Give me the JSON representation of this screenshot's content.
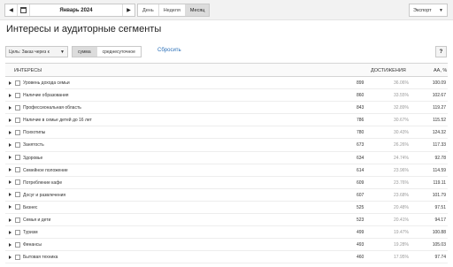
{
  "toolbar": {
    "date_label": "Январь 2024",
    "periods": [
      {
        "label": "День",
        "active": false
      },
      {
        "label": "Неделя",
        "active": false
      },
      {
        "label": "Месяц",
        "active": true
      }
    ],
    "export_label": "Экспорт"
  },
  "page_title": "Интересы и аудиторные сегменты",
  "filters": {
    "goal_label": "Цель: Заказ через к",
    "modes": [
      {
        "label": "сумма",
        "active": true
      },
      {
        "label": "среднесуточное",
        "active": false
      }
    ],
    "reset_label": "Сбросить",
    "help_label": "?"
  },
  "table": {
    "headers": {
      "name": "ИНТЕРЕСЫ",
      "reach": "ДОСТИЖЕНИЯ",
      "affinity": "АА, %"
    },
    "rows": [
      {
        "name": "Уровень дохода семьи",
        "count": "899",
        "pct": "36.06%",
        "aff": "100.09"
      },
      {
        "name": "Наличие образования",
        "count": "860",
        "pct": "33.55%",
        "aff": "102.67"
      },
      {
        "name": "Профессиональная область",
        "count": "843",
        "pct": "32.89%",
        "aff": "119.27"
      },
      {
        "name": "Наличие в семье детей до 16 лет",
        "count": "786",
        "pct": "30.67%",
        "aff": "115.52"
      },
      {
        "name": "Психотипы",
        "count": "780",
        "pct": "30.43%",
        "aff": "124.32"
      },
      {
        "name": "Занятость",
        "count": "673",
        "pct": "26.26%",
        "aff": "117.33"
      },
      {
        "name": "Здоровье",
        "count": "634",
        "pct": "24.74%",
        "aff": "92.78"
      },
      {
        "name": "Семейное положение",
        "count": "614",
        "pct": "23.96%",
        "aff": "114.59"
      },
      {
        "name": "Потребление кафе",
        "count": "609",
        "pct": "23.76%",
        "aff": "119.11"
      },
      {
        "name": "Досуг и развлечения",
        "count": "607",
        "pct": "23.68%",
        "aff": "101.79"
      },
      {
        "name": "Бизнес",
        "count": "525",
        "pct": "20.48%",
        "aff": "97.51"
      },
      {
        "name": "Семья и дети",
        "count": "523",
        "pct": "20.41%",
        "aff": "94.17"
      },
      {
        "name": "Туризм",
        "count": "499",
        "pct": "19.47%",
        "aff": "100.88"
      },
      {
        "name": "Финансы",
        "count": "493",
        "pct": "19.28%",
        "aff": "105.03"
      },
      {
        "name": "Бытовая техника",
        "count": "460",
        "pct": "17.95%",
        "aff": "97.74"
      }
    ]
  }
}
